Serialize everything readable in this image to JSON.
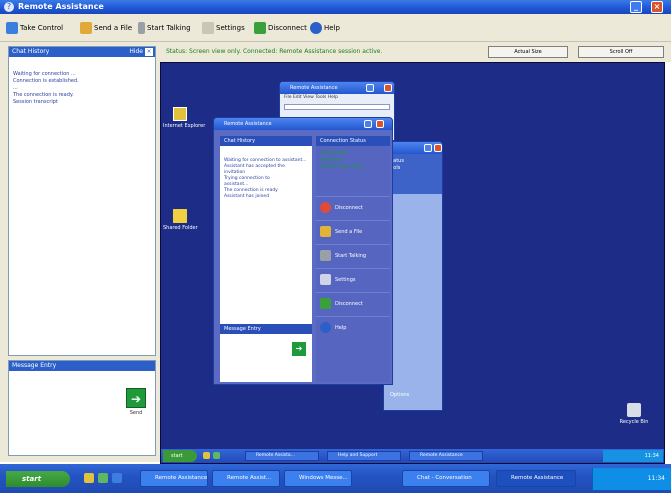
{
  "window": {
    "title": "Remote Assistance"
  },
  "toolbar": {
    "items": [
      {
        "label": "Take Control"
      },
      {
        "label": "Send a File"
      },
      {
        "label": "Start Talking"
      },
      {
        "label": "Settings"
      },
      {
        "label": "Disconnect"
      },
      {
        "label": "Help"
      }
    ]
  },
  "chat": {
    "header": "Chat History",
    "hide_label": "Hide",
    "lines": [
      "Waiting for connection ...",
      "",
      "",
      "Connection is established.",
      "...",
      "The connection is ready.",
      "Session transcript"
    ],
    "message_header": "Message Entry",
    "send_label": "Send"
  },
  "status": {
    "text": "Status: Screen view only. Connected: Remote Assistance session active.",
    "scale_button": "Actual Size",
    "scroll_button": "Scroll Off"
  },
  "remote": {
    "desktop_icons": [
      {
        "label": "Internet Explorer"
      },
      {
        "label": "Shared Folder"
      },
      {
        "label": "Recycle Bin"
      }
    ],
    "back_window_title": "Remote Assistance",
    "back_menu": "File  Edit  View  Tools  Help",
    "ra_window_title": "Remote Assistance",
    "chat_head": "Chat History",
    "chat_lines": [
      "Waiting for connection to assistant...",
      "Assistant has accepted the",
      "invitation",
      "Trying connection to",
      "assistant...",
      "The connection is ready",
      "Assistant has joined"
    ],
    "message_head": "Message Entry",
    "conn_head": "Connection Status",
    "conn_lines": [
      "Connected",
      "Assistant",
      "Screen View Only"
    ],
    "actions": [
      {
        "label": "Disconnect"
      },
      {
        "label": "Send a File"
      },
      {
        "label": "Start Talking"
      },
      {
        "label": "Settings"
      },
      {
        "label": "Disconnect"
      },
      {
        "label": "Help"
      }
    ],
    "side_items": [
      "Status",
      "",
      "Tools"
    ],
    "side_footer": "Options",
    "start": "start",
    "tasks": [
      "Remote Assista...",
      "Help and Support",
      "Remote Assistance"
    ],
    "clock": "11:34"
  },
  "taskbar": {
    "start": "start",
    "tasks": [
      {
        "label": "Remote Assistance"
      },
      {
        "label": "Remote Assist..."
      },
      {
        "label": "Windows Messe..."
      },
      {
        "label": "Chat - Conversation"
      },
      {
        "label": "Remote Assistance"
      }
    ],
    "clock": "11:34"
  }
}
